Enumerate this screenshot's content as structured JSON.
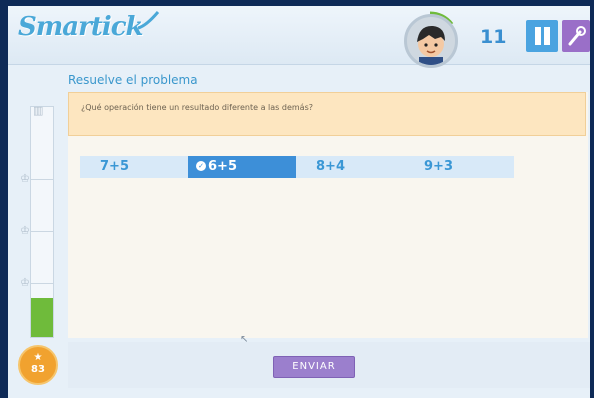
{
  "app": {
    "logo_text": "Smartick"
  },
  "header": {
    "score": "11",
    "pause_label": "",
    "tools_label": ""
  },
  "exercise": {
    "title": "Resuelve el problema",
    "question": "¿Qué operación tiene un resultado diferente a las demás?",
    "answers": [
      {
        "label": "7+5",
        "selected": false
      },
      {
        "label": "6+5",
        "selected": true
      },
      {
        "label": "8+4",
        "selected": false
      },
      {
        "label": "9+3",
        "selected": false
      }
    ],
    "submit_label": "ENVIAR"
  },
  "progress": {
    "coins": "83",
    "fill_fraction": 0.17
  },
  "colors": {
    "accent_blue": "#3d8fd8",
    "answer_bg": "#d8e9f8",
    "question_bg": "#fde6c0",
    "submit_purple": "#9b7fcd",
    "progress_green": "#6fbb3b",
    "coin_orange": "#f1a22f"
  },
  "icons": [
    "avatar-icon",
    "pause-icon",
    "wrench-icon",
    "star-icon",
    "check-icon",
    "medal-icon"
  ]
}
